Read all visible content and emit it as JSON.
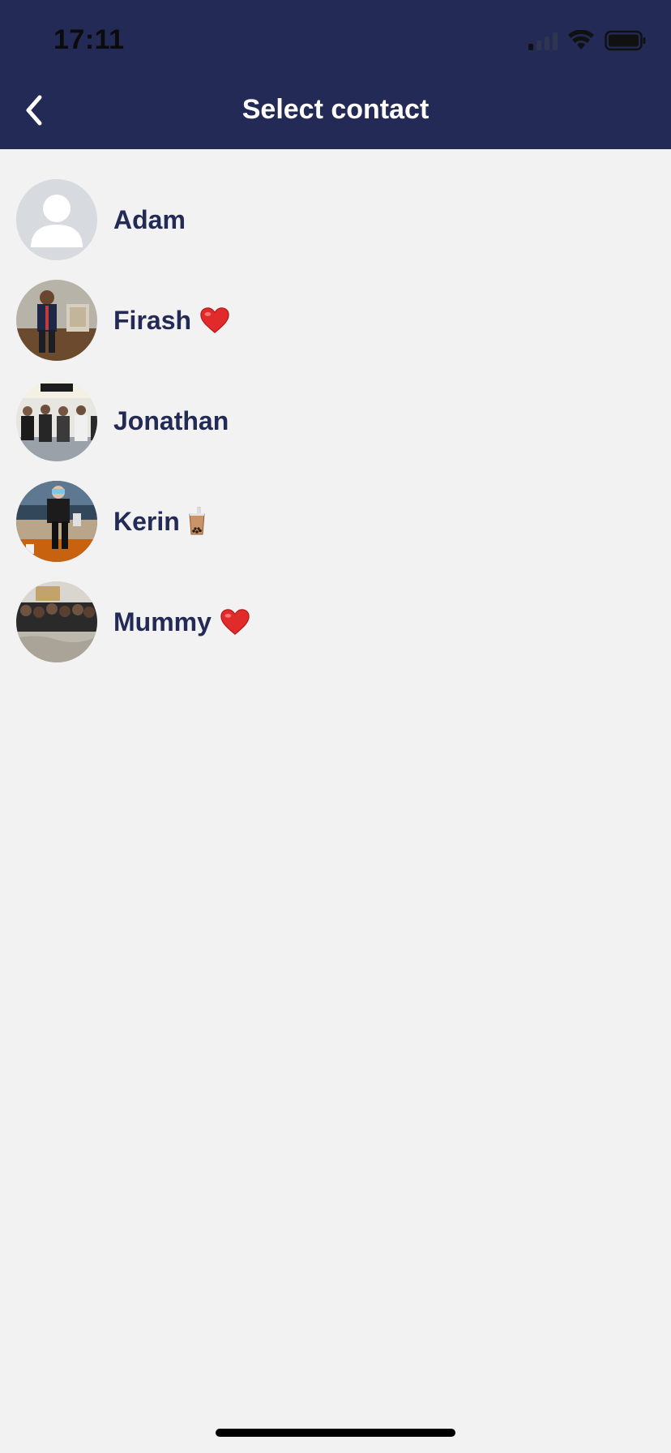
{
  "status_bar": {
    "time": "17:11"
  },
  "header": {
    "title": "Select contact",
    "background": "#222a55"
  },
  "contacts": [
    {
      "name": "Adam",
      "avatar": "default-person",
      "emoji": ""
    },
    {
      "name": "Firash",
      "avatar": "photo",
      "emoji": "heart"
    },
    {
      "name": "Jonathan",
      "avatar": "photo",
      "emoji": ""
    },
    {
      "name": "Kerin",
      "avatar": "photo",
      "emoji": "bubble-tea"
    },
    {
      "name": "Mummy",
      "avatar": "photo",
      "emoji": "heart"
    }
  ],
  "colors": {
    "accent": "#222a55",
    "background": "#f2f2f2",
    "name_text": "#222a55"
  }
}
